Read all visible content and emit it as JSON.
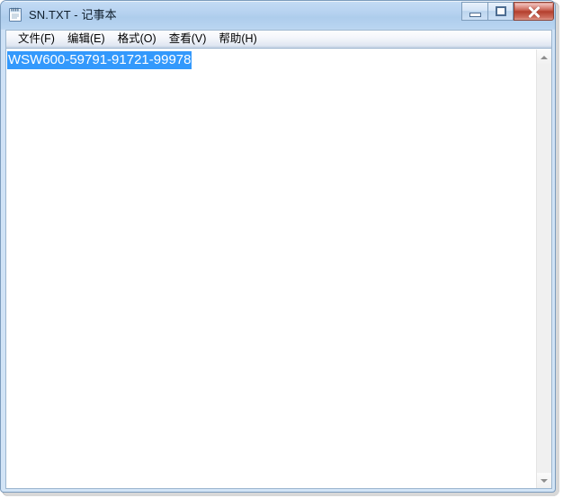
{
  "window": {
    "title": "SN.TXT - 记事本",
    "app_icon": "notepad-icon",
    "controls": {
      "minimize_label": "最小化",
      "maximize_label": "最大化",
      "close_label": "关闭"
    },
    "colors": {
      "titlebar_glass": "#b4d0ef",
      "frame_border": "#7c9cbd",
      "close_button": "#c0503f",
      "selection_highlight": "#3399fc",
      "client_background": "#ffffff"
    }
  },
  "menubar": {
    "items": [
      {
        "label": "文件(F)",
        "name": "menu-file"
      },
      {
        "label": "编辑(E)",
        "name": "menu-edit"
      },
      {
        "label": "格式(O)",
        "name": "menu-format"
      },
      {
        "label": "查看(V)",
        "name": "menu-view"
      },
      {
        "label": "帮助(H)",
        "name": "menu-help"
      }
    ]
  },
  "document": {
    "selected_text": "WSW600-59791-91721-99978",
    "is_selected": true,
    "lines": [
      "WSW600-59791-91721-99978"
    ]
  },
  "scrollbar": {
    "up_arrow": "scroll-up-arrow",
    "down_arrow": "scroll-down-arrow",
    "thumb_visible": false
  }
}
